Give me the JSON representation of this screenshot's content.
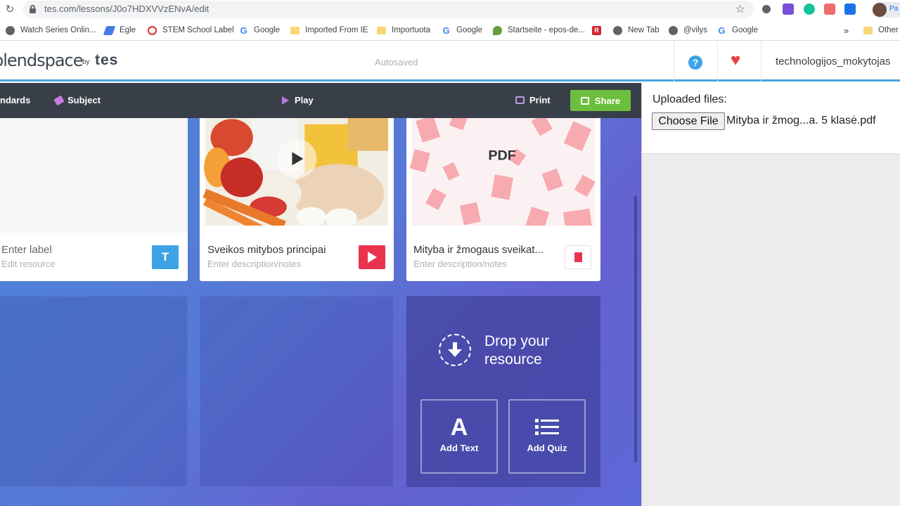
{
  "browser": {
    "url": "tes.com/lessons/J0o7HDXVVzENvA/edit",
    "profile_label": "Pa"
  },
  "bookmarks": {
    "items": [
      {
        "label": "Watch Series Onlin...",
        "icon": "globe-icon"
      },
      {
        "label": "Egle",
        "icon": "feather-icon"
      },
      {
        "label": "STEM School Label",
        "icon": "stem-icon"
      },
      {
        "label": "Google",
        "icon": "google-icon"
      },
      {
        "label": "Imported From IE",
        "icon": "folder-icon"
      },
      {
        "label": "Importuota",
        "icon": "folder-icon"
      },
      {
        "label": "Google",
        "icon": "google-icon"
      },
      {
        "label": "Startseite - epos-de...",
        "icon": "leaf-icon"
      },
      {
        "label": "",
        "icon": "r-icon"
      },
      {
        "label": "New Tab",
        "icon": "globe-icon"
      },
      {
        "label": "@vilys",
        "icon": "globe-icon"
      },
      {
        "label": "Google",
        "icon": "google-icon"
      }
    ],
    "more": "»",
    "other": "Other"
  },
  "header": {
    "logo_text": "blendspace",
    "logo_by": "by",
    "logo_brand": "tes",
    "autosaved": "Autosaved",
    "help": "?",
    "username": "technologijos_mokytojas"
  },
  "toolbar": {
    "standards": "ndards",
    "subject": "Subject",
    "play": "Play",
    "print": "Print",
    "share": "Share"
  },
  "cards": [
    {
      "title": "Enter label",
      "desc": "Edit resource",
      "badge": "T",
      "badge_color": "#3ea2e6"
    },
    {
      "title": "Sveikos mitybos principai",
      "desc": "Enter description/notes",
      "badge": "play",
      "badge_color": "#e9334e"
    },
    {
      "title": "Mityba ir žmogaus sveikat...",
      "desc": "Enter description/notes",
      "badge": "pdf",
      "badge_color": "#ffffff",
      "thumb_label": "PDF"
    }
  ],
  "dropzone": {
    "text": "Drop your resource",
    "add_text_glyph": "A",
    "add_text": "Add Text",
    "add_quiz": "Add Quiz"
  },
  "right_panel": {
    "uploaded_label": "Uploaded files:",
    "choose_file": "Choose File",
    "filename": "Mityba ir žmog...a. 5 klasė.pdf"
  }
}
